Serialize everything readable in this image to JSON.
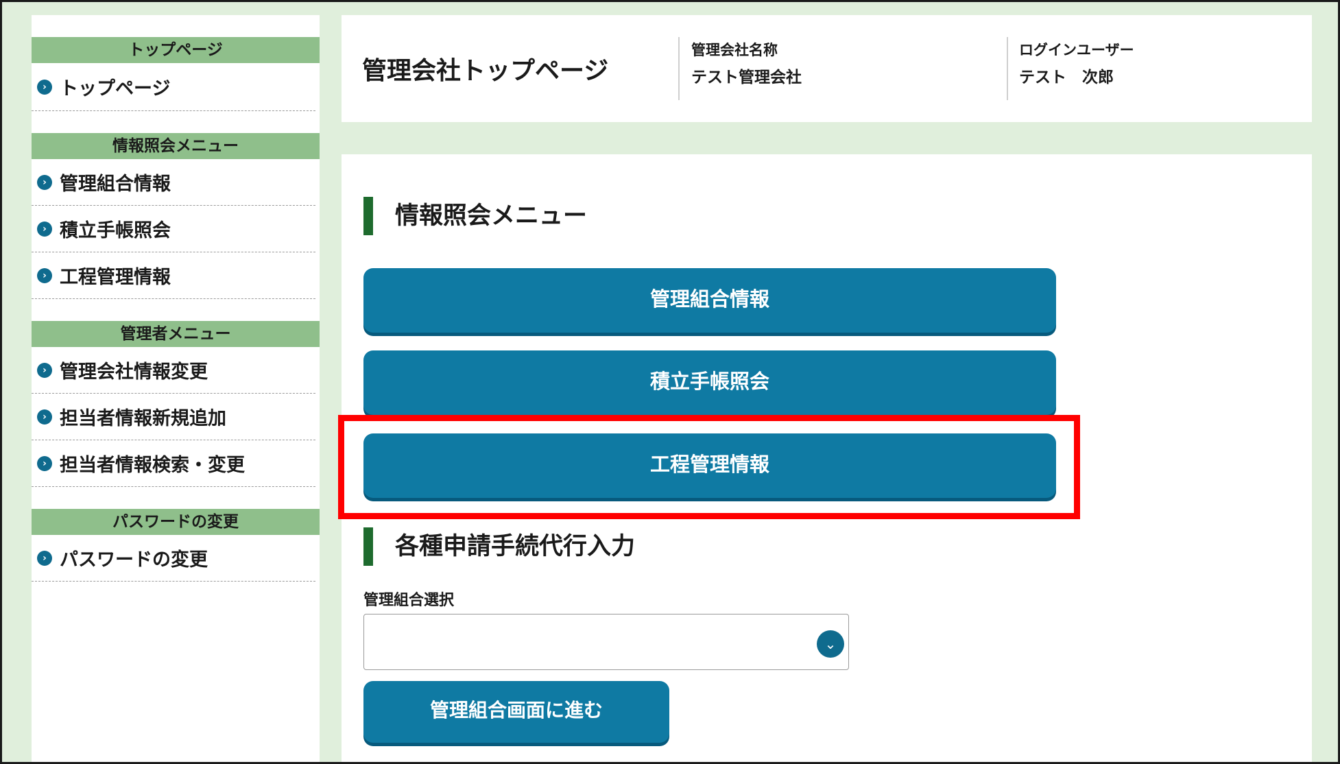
{
  "sidebar": {
    "sections": [
      {
        "heading": "トップページ",
        "items": [
          {
            "label": "トップページ"
          }
        ]
      },
      {
        "heading": "情報照会メニュー",
        "items": [
          {
            "label": "管理組合情報"
          },
          {
            "label": "積立手帳照会"
          },
          {
            "label": "工程管理情報"
          }
        ]
      },
      {
        "heading": "管理者メニュー",
        "items": [
          {
            "label": "管理会社情報変更"
          },
          {
            "label": "担当者情報新規追加"
          },
          {
            "label": "担当者情報検索・変更"
          }
        ]
      },
      {
        "heading": "パスワードの変更",
        "items": [
          {
            "label": "パスワードの変更"
          }
        ]
      }
    ],
    "bullet_icon": "chevron-right-circle-icon"
  },
  "header": {
    "title": "管理会社トップページ",
    "company_label": "管理会社名称",
    "company_name": "テスト管理会社",
    "user_label": "ログインユーザー",
    "user_name": "テスト　次郎"
  },
  "main": {
    "info_section_title": "情報照会メニュー",
    "menu_buttons": [
      {
        "label": "管理組合情報"
      },
      {
        "label": "積立手帳照会"
      },
      {
        "label": "工程管理情報",
        "highlighted": true
      }
    ],
    "apply_section_title": "各種申請手続代行入力",
    "select_label": "管理組合選択",
    "select_value": "",
    "select_icon": "chevron-down-circle-icon",
    "go_button_label": "管理組合画面に進む"
  },
  "colors": {
    "page_background": "#e0efdc",
    "sidebar_heading": "#8fbf8b",
    "button": "#0f7aa3",
    "button_shadow": "#075a7d",
    "section_accent": "#1e6b2e",
    "highlight": "#ff0000"
  }
}
